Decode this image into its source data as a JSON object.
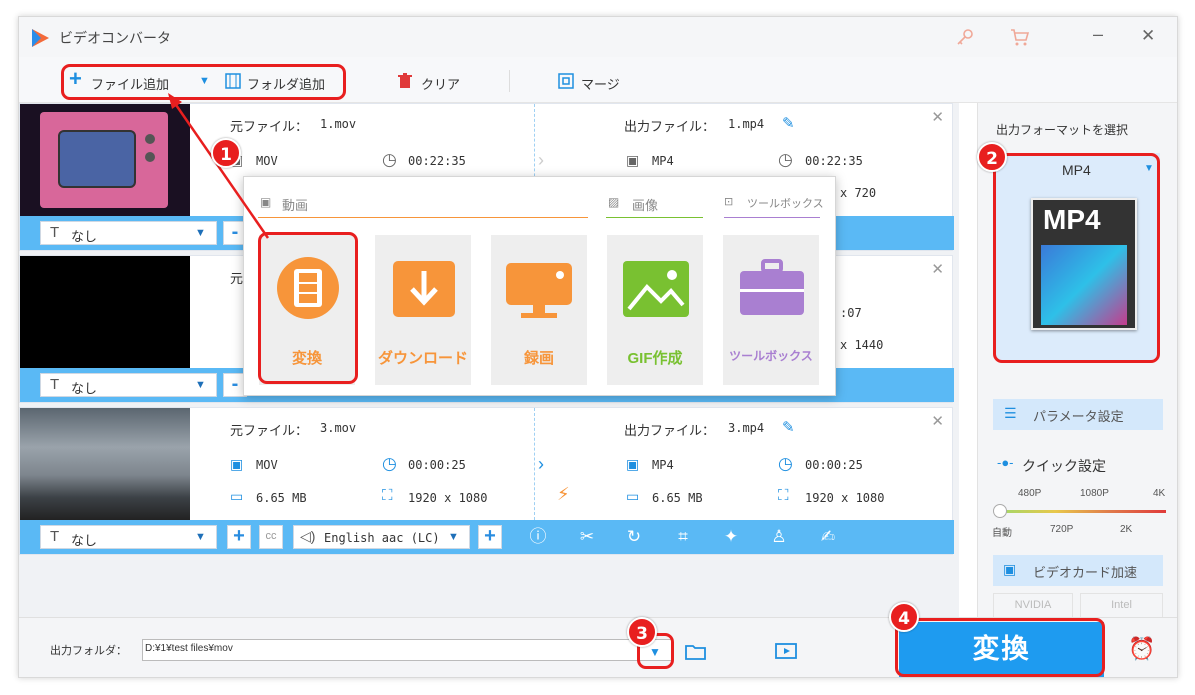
{
  "app": {
    "title": "ビデオコンバータ"
  },
  "toolbar": {
    "add_file": "ファイル追加",
    "add_folder": "フォルダ追加",
    "clear": "クリア",
    "merge": "マージ"
  },
  "files": [
    {
      "src_label": "元ファイル：",
      "src_name": "1.mov",
      "in_format": "MOV",
      "in_duration": "00:22:35",
      "out_label": "出力ファイル：",
      "out_name": "1.mp4",
      "out_format": "MP4",
      "out_duration": "00:22:35",
      "out_res_partial": "x 720",
      "subtitle": "なし"
    },
    {
      "src_label": "元",
      "out_duration_partial": ":07",
      "out_res_partial": "x 1440",
      "subtitle": "なし"
    },
    {
      "src_label": "元ファイル：",
      "src_name": "3.mov",
      "in_format": "MOV",
      "in_duration": "00:00:25",
      "in_size": "6.65 MB",
      "in_res": "1920 x 1080",
      "out_label": "出力ファイル：",
      "out_name": "3.mp4",
      "out_format": "MP4",
      "out_duration": "00:00:25",
      "out_size": "6.65 MB",
      "out_res": "1920 x 1080",
      "subtitle": "なし",
      "audio": "English aac (LC)"
    }
  ],
  "popup": {
    "cat_video": "動画",
    "cat_image": "画像",
    "cat_toolbox": "ツールボックス",
    "tiles": [
      "変換",
      "ダウンロード",
      "録画",
      "GIF作成",
      "ツールボックス"
    ]
  },
  "right": {
    "select_label": "出力フォーマットを選択",
    "format": "MP4",
    "format_icon_text": "MP4",
    "param": "パラメータ設定",
    "quick": "クイック設定",
    "q_top": [
      "480P",
      "1080P",
      "4K"
    ],
    "q_bottom": [
      "自動",
      "720P",
      "2K"
    ],
    "gpu": "ビデオカード加速",
    "nvidia": "NVIDIA",
    "intel": "Intel"
  },
  "bottom": {
    "output_label": "出力フォルダ：",
    "output_path": "D:¥1¥test files¥mov",
    "convert": "変換"
  },
  "badges": [
    "1",
    "2",
    "3",
    "4"
  ],
  "colors": {
    "accent": "#1e9bf0",
    "badge": "#e81f1f",
    "orange": "#f7953a",
    "green": "#79c131",
    "purple": "#a97fd1"
  }
}
